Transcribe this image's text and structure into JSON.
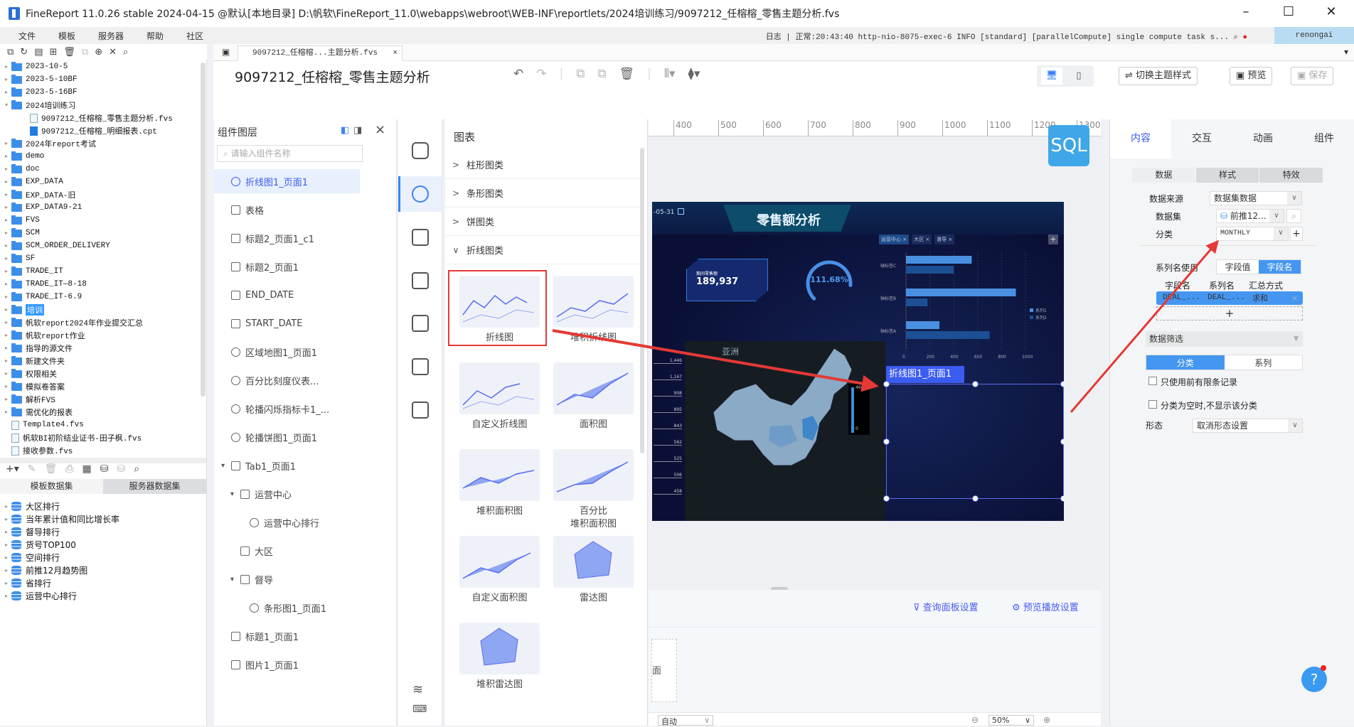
{
  "window": {
    "title": "FineReport 11.0.26 stable 2024-04-15 @默认[本地目录]   D:\\帆软\\FineReport_11.0\\webapps\\webroot\\WEB-INF\\reportlets/2024培训练习/9097212_任榕榕_零售主题分析.fvs"
  },
  "menu": [
    "文件",
    "模板",
    "服务器",
    "帮助",
    "社区"
  ],
  "status": {
    "log_label": "日志",
    "log_text": "正常:20:43:40 http-nio-8075-exec-6 INFO [standard] [parallelCompute] single compute task s...",
    "user": "renongai"
  },
  "file_tab": "9097212_任榕榕...主题分析.fvs",
  "tree": [
    {
      "label": "2023-10-5",
      "type": "folder",
      "level": 0,
      "arrow": "▸"
    },
    {
      "label": "2023-5-10BF",
      "type": "folder",
      "level": 0,
      "arrow": "▸"
    },
    {
      "label": "2023-5-16BF",
      "type": "folder",
      "level": 0,
      "arrow": "▸"
    },
    {
      "label": "2024培训练习",
      "type": "folder",
      "level": 0,
      "arrow": "▾"
    },
    {
      "label": "9097212_任榕榕_零售主题分析.fvs",
      "type": "file",
      "level": 1,
      "arrow": ""
    },
    {
      "label": "9097212_任榕榕_明细报表.cpt",
      "type": "cpt",
      "level": 1,
      "arrow": ""
    },
    {
      "label": "2024年report考试",
      "type": "folder",
      "level": 0,
      "arrow": "▸"
    },
    {
      "label": "demo",
      "type": "folder",
      "level": 0,
      "arrow": "▸"
    },
    {
      "label": "doc",
      "type": "folder",
      "level": 0,
      "arrow": "▸"
    },
    {
      "label": "EXP_DATA",
      "type": "folder",
      "level": 0,
      "arrow": "▸"
    },
    {
      "label": "EXP_DATA-旧",
      "type": "folder",
      "level": 0,
      "arrow": "▸"
    },
    {
      "label": "EXP_DATA9-21",
      "type": "folder",
      "level": 0,
      "arrow": "▸"
    },
    {
      "label": "FVS",
      "type": "folder",
      "level": 0,
      "arrow": "▸"
    },
    {
      "label": "SCM",
      "type": "folder",
      "level": 0,
      "arrow": "▸"
    },
    {
      "label": "SCM_ORDER_DELIVERY",
      "type": "folder",
      "level": 0,
      "arrow": "▸"
    },
    {
      "label": "SF",
      "type": "folder",
      "level": 0,
      "arrow": "▸"
    },
    {
      "label": "TRADE_IT",
      "type": "folder",
      "level": 0,
      "arrow": "▸"
    },
    {
      "label": "TRADE_IT—8-18",
      "type": "folder",
      "level": 0,
      "arrow": "▸"
    },
    {
      "label": "TRADE_IT-6.9",
      "type": "folder",
      "level": 0,
      "arrow": "▸"
    },
    {
      "label": "培训",
      "type": "folder",
      "level": 0,
      "arrow": "▸",
      "selected": true
    },
    {
      "label": "帆软report2024年作业提交汇总",
      "type": "folder",
      "level": 0,
      "arrow": "▸"
    },
    {
      "label": "帆软report作业",
      "type": "folder",
      "level": 0,
      "arrow": "▸"
    },
    {
      "label": "指导的源文件",
      "type": "folder",
      "level": 0,
      "arrow": "▸"
    },
    {
      "label": "新建文件夹",
      "type": "folder",
      "level": 0,
      "arrow": "▸"
    },
    {
      "label": "权限相关",
      "type": "folder",
      "level": 0,
      "arrow": "▸"
    },
    {
      "label": "模拟卷答案",
      "type": "folder",
      "level": 0,
      "arrow": "▸"
    },
    {
      "label": "解析FVS",
      "type": "folder",
      "level": 0,
      "arrow": "▸"
    },
    {
      "label": "需优化的报表",
      "type": "folder",
      "level": 0,
      "arrow": "▸"
    },
    {
      "label": "Template4.fvs",
      "type": "file",
      "level": 0,
      "arrow": ""
    },
    {
      "label": "帆软BI初阶结业证书-田子枫.fvs",
      "type": "file",
      "level": 0,
      "arrow": ""
    },
    {
      "label": "接收参数.fvs",
      "type": "file",
      "level": 0,
      "arrow": ""
    }
  ],
  "dataset_tabs": [
    "模板数据集",
    "服务器数据集"
  ],
  "datasets": [
    "大区排行",
    "当年累计值和同比增长率",
    "督导排行",
    "货号TOP100",
    "空间排行",
    "前推12月趋势图",
    "省排行",
    "运营中心排行"
  ],
  "header": {
    "title": "9097212_任榕榕_零售主题分析",
    "switch_theme": "切换主题样式",
    "preview": "预览",
    "save": "保存"
  },
  "layers": {
    "title": "组件图层",
    "search_placeholder": "请输入组件名称",
    "items": [
      {
        "label": "折线图1_页面1",
        "icon": "pie",
        "indent": 0,
        "selected": true
      },
      {
        "label": "表格",
        "icon": "text",
        "indent": 0
      },
      {
        "label": "标题2_页面1_c1",
        "icon": "text",
        "indent": 0
      },
      {
        "label": "标题2_页面1",
        "icon": "text",
        "indent": 0
      },
      {
        "label": "END_DATE",
        "icon": "grid",
        "indent": 0
      },
      {
        "label": "START_DATE",
        "icon": "grid",
        "indent": 0
      },
      {
        "label": "区域地图1_页面1",
        "icon": "pie",
        "indent": 0
      },
      {
        "label": "百分比刻度仪表...",
        "icon": "pie",
        "indent": 0
      },
      {
        "label": "轮播闪烁指标卡1_...",
        "icon": "pie",
        "indent": 0
      },
      {
        "label": "轮播饼图1_页面1",
        "icon": "pie",
        "indent": 0
      },
      {
        "label": "Tab1_页面1",
        "icon": "tab",
        "indent": 0,
        "arrow": "▾"
      },
      {
        "label": "运营中心",
        "icon": "folder",
        "indent": 1,
        "arrow": "▾"
      },
      {
        "label": "运营中心排行",
        "icon": "pie",
        "indent": 2
      },
      {
        "label": "大区",
        "icon": "folder",
        "indent": 1
      },
      {
        "label": "督导",
        "icon": "folder",
        "indent": 1,
        "arrow": "▾"
      },
      {
        "label": "条形图1_页面1",
        "icon": "pie",
        "indent": 2
      },
      {
        "label": "标题1_页面1",
        "icon": "text",
        "indent": 0
      },
      {
        "label": "图片1_页面1",
        "icon": "image",
        "indent": 0
      }
    ]
  },
  "chart_panel": {
    "title": "图表",
    "categories": [
      {
        "label": "柱形图类",
        "arrow": ">"
      },
      {
        "label": "条形图类",
        "arrow": ">"
      },
      {
        "label": "饼图类",
        "arrow": ">"
      },
      {
        "label": "折线图类",
        "arrow": "∨"
      }
    ],
    "types": [
      "折线图",
      "堆积折线图",
      "自定义折线图",
      "面积图",
      "堆积面积图",
      "百分比\n堆积面积图",
      "自定义面积图",
      "雷达图",
      "堆积雷达图"
    ]
  },
  "ruler": [
    "400",
    "500",
    "600",
    "700",
    "800",
    "900",
    "1000",
    "1100",
    "1200",
    "1300"
  ],
  "sql_badge": "SQL",
  "dashboard": {
    "date": "-05-31",
    "title": "零售额分析",
    "kpi_label": "期间零售额",
    "kpi_value": "189,937",
    "gauge": "111.68%",
    "gauge_fraction": 0.85,
    "tabs": [
      "运营中心",
      "大区",
      "督导"
    ],
    "left_values": [
      "1,446",
      "1,167",
      "908",
      "895",
      "843",
      "562",
      "525",
      "506",
      "458"
    ],
    "map_label": "亚洲",
    "map_scale": [
      "4600",
      "0"
    ],
    "selected_label": "折线图1_页面1",
    "chart_data": {
      "type": "bar",
      "categories": [
        "轴标签C",
        "轴标签B",
        "轴标签A"
      ],
      "series": [
        {
          "name": "系列1",
          "values": [
            550,
            920,
            280
          ]
        },
        {
          "name": "系列2",
          "values": [
            400,
            180,
            700
          ]
        }
      ],
      "xlim": [
        0,
        1000
      ],
      "ticks": [
        "0",
        "200",
        "400",
        "600",
        "800",
        "1000"
      ],
      "colors": [
        "#4a90e2",
        "#1c4f94"
      ]
    }
  },
  "canvas_bottom": {
    "query_panel": "查询面板设置",
    "preview_play": "预览播放设置",
    "page_thumb": "面",
    "layout_select": "自动",
    "zoom": "50%"
  },
  "right_panel": {
    "tabs": [
      "内容",
      "交互",
      "动画",
      "组件"
    ],
    "subtabs": [
      "数据",
      "样式",
      "特效"
    ],
    "source_label": "数据来源",
    "source_value": "数据集数据",
    "dataset_label": "数据集",
    "dataset_value": "前推12...",
    "category_label": "分类",
    "category_value": "MONTHLY",
    "series_name_label": "系列名使用",
    "series_opts": [
      "字段值",
      "字段名"
    ],
    "cols": [
      "字段名",
      "系列名",
      "汇总方式"
    ],
    "row": [
      "DEAL_...",
      "DEAL_...",
      "求和"
    ],
    "filter_label": "数据筛选",
    "filter_opts": [
      "分类",
      "系列"
    ],
    "check1": "只使用前有限条记录",
    "check2": "分类为空时,不显示该分类",
    "shape_label": "形态",
    "shape_value": "取消形态设置"
  },
  "accent": "#3b82f6"
}
